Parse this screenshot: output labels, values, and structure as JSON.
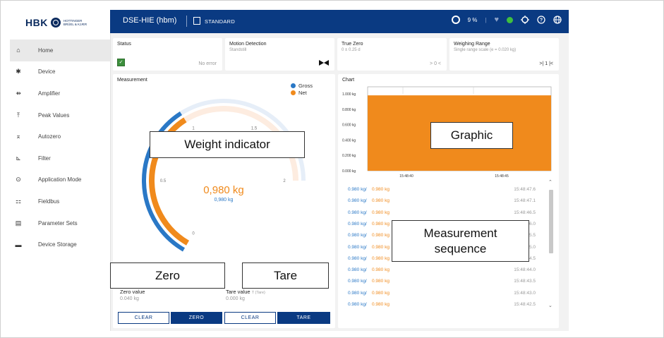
{
  "brand": {
    "name": "HBK",
    "subtitle": "HOTTINGER BRÜEL & KJÆR"
  },
  "sidebar": {
    "items": [
      {
        "label": "Home",
        "icon": "home-icon",
        "glyph": "⌂"
      },
      {
        "label": "Device",
        "icon": "gear-icon",
        "glyph": "✱"
      },
      {
        "label": "Amplifier",
        "icon": "amplifier-icon",
        "glyph": "⇻"
      },
      {
        "label": "Peak Values",
        "icon": "peak-icon",
        "glyph": "⤒"
      },
      {
        "label": "Autozero",
        "icon": "autozero-icon",
        "glyph": "⌅"
      },
      {
        "label": "Filter",
        "icon": "filter-icon",
        "glyph": "⊾"
      },
      {
        "label": "Application Mode",
        "icon": "application-mode-icon",
        "glyph": "⊙"
      },
      {
        "label": "Fieldbus",
        "icon": "fieldbus-icon",
        "glyph": "⚏"
      },
      {
        "label": "Parameter Sets",
        "icon": "parameter-sets-icon",
        "glyph": "▤"
      },
      {
        "label": "Device Storage",
        "icon": "folder-icon",
        "glyph": "▬"
      }
    ]
  },
  "header": {
    "device": "DSE-HIE (hbm)",
    "mode": "STANDARD",
    "load_pct": "9 %"
  },
  "status_cards": {
    "status": {
      "title": "Status",
      "value": "No error"
    },
    "motion": {
      "title": "Motion Detection",
      "sub": "Standstill"
    },
    "true_zero": {
      "title": "True Zero",
      "sub": "0 ± 0.25 d",
      "value": "> 0 <"
    },
    "range": {
      "title": "Weighing Range",
      "sub": "Single range scale (e = 0.020 kg)",
      "value": ">| 1 |<"
    }
  },
  "measurement": {
    "title": "Measurement",
    "legend_gross": "Gross",
    "legend_net": "Net",
    "big_value": "0,980 kg",
    "small_value": "0,980 kg",
    "ticks": [
      "0",
      "0.5",
      "1",
      "1.5",
      "2"
    ],
    "fraction_gross": 0.49,
    "fraction_net": 0.49,
    "overlay_weight": "Weight indicator",
    "overlay_zero": "Zero",
    "overlay_tare": "Tare",
    "zero_label": "Zero value",
    "zero_value": "0.040 kg",
    "tare_label": "Tare value",
    "tare_hint": "T (Tare)",
    "tare_value": "0.000 kg",
    "btn_clear": "CLEAR",
    "btn_zero": "ZERO",
    "btn_tare": "TARE"
  },
  "chart_panel": {
    "title": "Chart",
    "overlay_graphic": "Graphic",
    "overlay_sequence_1": "Measurement",
    "overlay_sequence_2": "sequence"
  },
  "chart_data": {
    "type": "area",
    "x": [
      "15:48:40",
      "15:48:45"
    ],
    "ylim": [
      0,
      1.0
    ],
    "yticks": [
      "1.000 kg",
      "0.800 kg",
      "0.600 kg",
      "0.400 kg",
      "0.200 kg",
      "0.000 kg"
    ],
    "series": [
      {
        "values": [
          0.98,
          0.98
        ]
      }
    ],
    "colors": {
      "net": "#f08a1c",
      "gross": "#2a78c6"
    }
  },
  "sequence": [
    {
      "gross": "0.980 kg/",
      "net": "0.980 kg",
      "time": "15:48:47.6"
    },
    {
      "gross": "0.980 kg/",
      "net": "0.980 kg",
      "time": "15:48:47.1"
    },
    {
      "gross": "0.980 kg/",
      "net": "0.980 kg",
      "time": "15:48:46.5"
    },
    {
      "gross": "0.980 kg/",
      "net": "0.980 kg",
      "time": "15:48:46.0"
    },
    {
      "gross": "0.980 kg/",
      "net": "0.980 kg",
      "time": "15:48:45.5"
    },
    {
      "gross": "0.980 kg/",
      "net": "0.980 kg",
      "time": "15:48:45.0"
    },
    {
      "gross": "0.980 kg/",
      "net": "0.980 kg",
      "time": "15:48:44.5"
    },
    {
      "gross": "0.980 kg/",
      "net": "0.980 kg",
      "time": "15:48:44.0"
    },
    {
      "gross": "0.980 kg/",
      "net": "0.980 kg",
      "time": "15:48:43.5"
    },
    {
      "gross": "0.980 kg/",
      "net": "0.980 kg",
      "time": "15:48:43.0"
    },
    {
      "gross": "0.980 kg/",
      "net": "0.980 kg",
      "time": "15:48:42.5"
    }
  ],
  "colors": {
    "brand": "#0a3a82",
    "gross": "#2a78c6",
    "net": "#f08a1c",
    "ok": "#3fbf3f"
  }
}
